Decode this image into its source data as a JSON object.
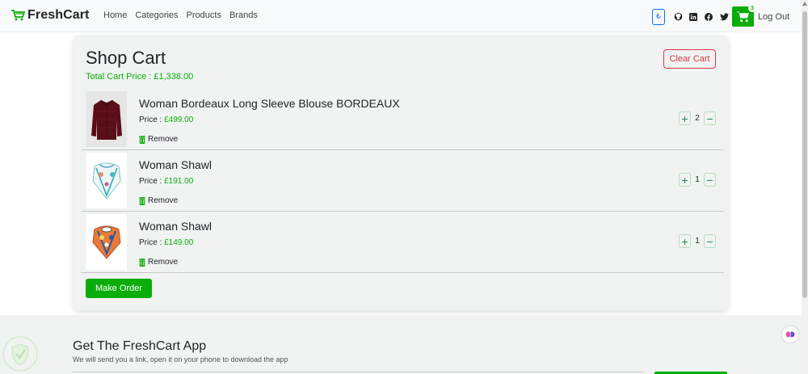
{
  "navbar": {
    "brand": "FreshCart",
    "links": [
      "Home",
      "Categories",
      "Products",
      "Brands"
    ],
    "lang": "₺",
    "cart_count": "3",
    "logout": "Log Out"
  },
  "cart": {
    "title": "Shop Cart",
    "total_label": "Total Cart Price : ",
    "total_value": "£1,338.00",
    "clear_label": "Clear Cart",
    "price_label": "Price : ",
    "remove_label": "Remove",
    "items": [
      {
        "name": "Woman Bordeaux Long Sleeve Blouse BORDEAUX",
        "price": "£499.00",
        "qty": "2"
      },
      {
        "name": "Woman Shawl",
        "price": "£191.00",
        "qty": "1"
      },
      {
        "name": "Woman Shawl",
        "price": "£149.00",
        "qty": "1"
      }
    ],
    "order_label": "Make Order"
  },
  "app": {
    "title": "Get The FreshCart App",
    "subtitle": "We will send you a link, open it on your phone to download the app"
  },
  "colors": {
    "brand_green": "#0aad0a",
    "danger": "#dc3545",
    "panel_bg": "#f0f3f2"
  }
}
